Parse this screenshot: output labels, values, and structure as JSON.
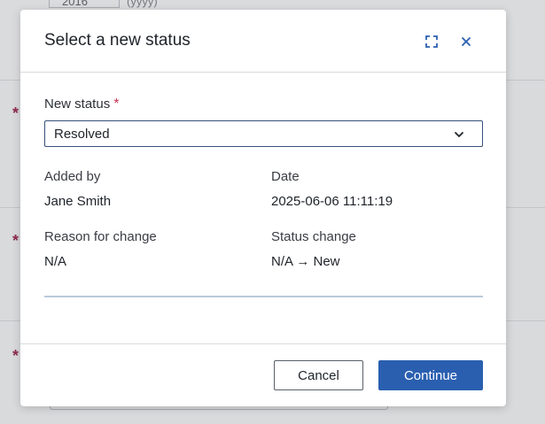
{
  "background": {
    "year_value": "2016",
    "year_hint": "(yyyy)"
  },
  "dialog": {
    "title": "Select a new status",
    "expand_icon": "fullscreen-icon",
    "close_icon": "close-icon"
  },
  "form": {
    "new_status_label": "New status",
    "required_marker": "*",
    "new_status_value": "Resolved"
  },
  "details": {
    "added_by_label": "Added by",
    "added_by_value": "Jane Smith",
    "date_label": "Date",
    "date_value": "2025-06-06 11:11:19",
    "reason_label": "Reason for change",
    "reason_value": "N/A",
    "status_change_label": "Status change",
    "status_change_value": "N/A → New"
  },
  "footer": {
    "cancel_label": "Cancel",
    "continue_label": "Continue"
  },
  "colors": {
    "primary": "#2a5fb0",
    "required": "#c63250",
    "background_asterisk": "#8b2b4b"
  }
}
